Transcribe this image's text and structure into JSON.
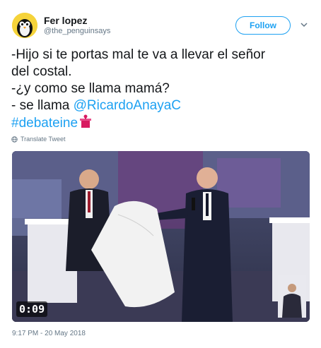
{
  "header": {
    "display_name": "Fer lopez",
    "handle": "@the_penguinsays",
    "follow_label": "Follow"
  },
  "tweet": {
    "line1": "-Hijo si te portas mal te va a llevar el señor",
    "line2": "del costal.",
    "line3": "-¿y como se llama mamá?",
    "line4_prefix": "- se llama ",
    "mention": "@RicardoAnayaC",
    "hashtag": "#debateine",
    "translate_label": "Translate Tweet"
  },
  "media": {
    "video_time": "0:09"
  },
  "footer": {
    "timestamp": "9:17 PM - 20 May 2018"
  },
  "icons": {
    "avatar": "penguin-avatar",
    "follow_menu": "chevron-down-icon",
    "translate": "globe-icon",
    "emoji": "podium-emoji"
  },
  "colors": {
    "link": "#1da1f2",
    "text": "#14171a",
    "muted": "#657786"
  }
}
